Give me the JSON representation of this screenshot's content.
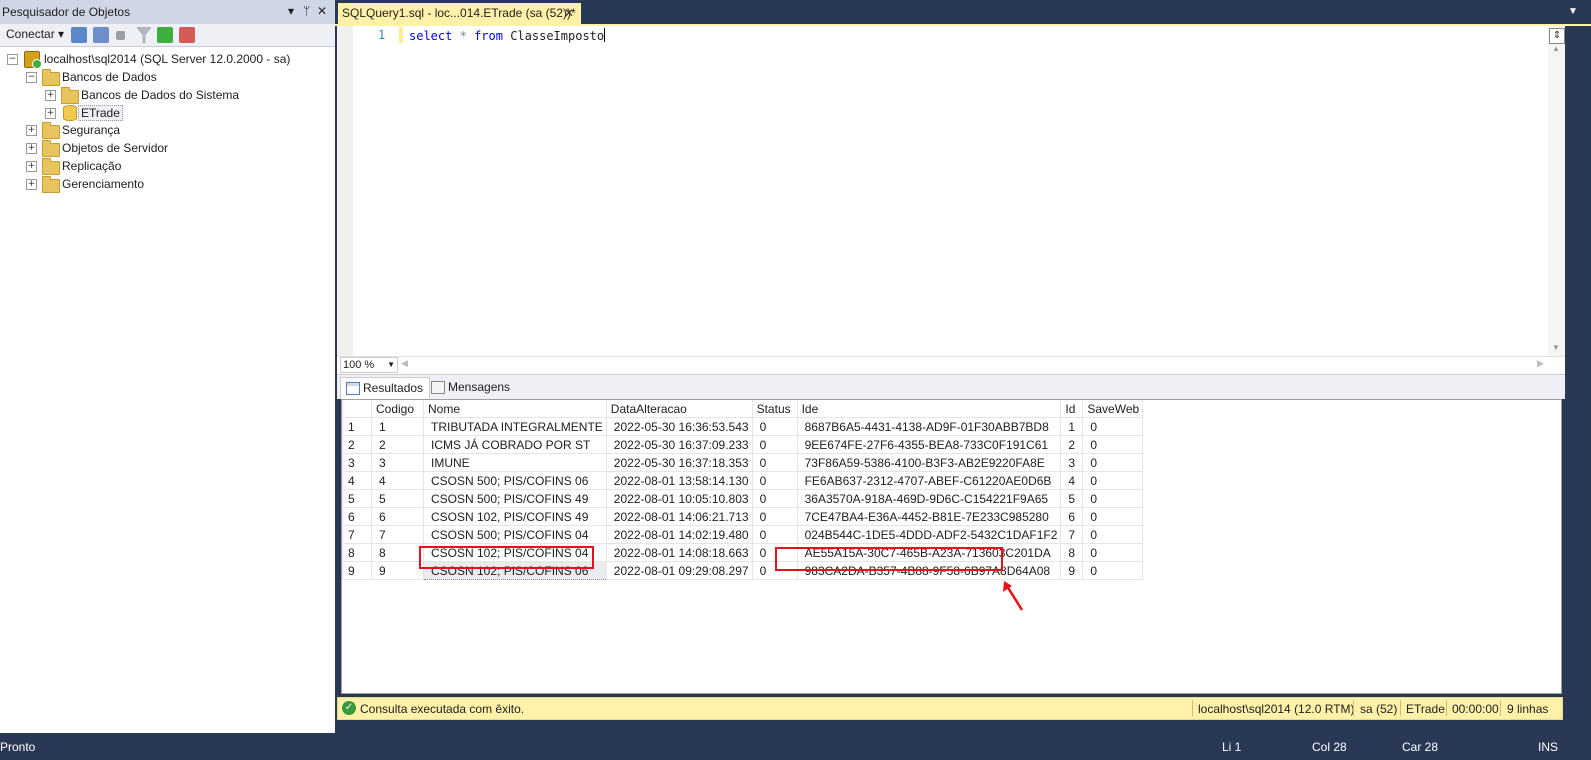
{
  "object_explorer": {
    "title": "Pesquisador de Objetos",
    "pin_label": "▾ ᵖ",
    "close_label": "✕",
    "toolbar": {
      "connect_label": "Conectar ▾"
    },
    "tree": {
      "server": "localhost\\sql2014 (SQL Server 12.0.2000 - sa)",
      "databases": "Bancos de Dados",
      "system_dbs": "Bancos de Dados do Sistema",
      "etrade": "ETrade",
      "security": "Segurança",
      "server_objects": "Objetos de Servidor",
      "replication": "Replicação",
      "management": "Gerenciamento"
    }
  },
  "document_tab": {
    "label": "SQLQuery1.sql - loc...014.ETrade (sa (52))*",
    "close": "✕"
  },
  "editor": {
    "line_number": "1",
    "code": {
      "kw1": "select",
      "star": "*",
      "kw2": "from",
      "table": "ClasseImposto"
    }
  },
  "zoom": "100 %",
  "result_tabs": {
    "results": "Resultados",
    "messages": "Mensagens"
  },
  "grid": {
    "columns": [
      "Codigo",
      "Nome",
      "DataAlteracao",
      "Status",
      "Ide",
      "Id",
      "SaveWeb"
    ],
    "rows": [
      [
        "1",
        "1",
        "TRIBUTADA INTEGRALMENTE",
        "2022-05-30 16:36:53.543",
        "0",
        "8687B6A5-4431-4138-AD9F-01F30ABB7BD8",
        "1",
        "0"
      ],
      [
        "2",
        "2",
        "ICMS JÁ COBRADO POR ST",
        "2022-05-30 16:37:09.233",
        "0",
        "9EE674FE-27F6-4355-BEA8-733C0F191C61",
        "2",
        "0"
      ],
      [
        "3",
        "3",
        "IMUNE",
        "2022-05-30 16:37:18.353",
        "0",
        "73F86A59-5386-4100-B3F3-AB2E9220FA8E",
        "3",
        "0"
      ],
      [
        "4",
        "4",
        "CSOSN 500; PIS/COFINS 06",
        "2022-08-01 13:58:14.130",
        "0",
        "FE6AB637-2312-4707-ABEF-C61220AE0D6B",
        "4",
        "0"
      ],
      [
        "5",
        "5",
        "CSOSN 500; PIS/COFINS 49",
        "2022-08-01 10:05:10.803",
        "0",
        "36A3570A-918A-469D-9D6C-C154221F9A65",
        "5",
        "0"
      ],
      [
        "6",
        "6",
        "CSOSN 102, PIS/COFINS 49",
        "2022-08-01 14:06:21.713",
        "0",
        "7CE47BA4-E36A-4452-B81E-7E233C985280",
        "6",
        "0"
      ],
      [
        "7",
        "7",
        "CSOSN 500; PIS/COFINS 04",
        "2022-08-01 14:02:19.480",
        "0",
        "024B544C-1DE5-4DDD-ADF2-5432C1DAF1F2",
        "7",
        "0"
      ],
      [
        "8",
        "8",
        "CSOSN 102; PIS/COFINS 04",
        "2022-08-01 14:08:18.663",
        "0",
        "AE55A15A-30C7-465B-A23A-713603C201DA",
        "8",
        "0"
      ],
      [
        "9",
        "9",
        "CSOSN 102; PIS/COFINS 06",
        "2022-08-01 09:29:08.297",
        "0",
        "983CA2DA-B357-4B88-9F58-6B97A8D64A08",
        "9",
        "0"
      ]
    ]
  },
  "query_status": {
    "message": "Consulta executada com êxito.",
    "server": "localhost\\sql2014 (12.0 RTM)",
    "user": "sa (52)",
    "database": "ETrade",
    "elapsed": "00:00:00",
    "rows": "9 linhas"
  },
  "status_bar": {
    "ready": "Pronto",
    "line": "Li 1",
    "col": "Col 28",
    "char": "Car 28",
    "mode": "INS"
  },
  "colors": {
    "highlight": "#e8101a",
    "tab_active": "#fff1a8",
    "chrome": "#293955"
  }
}
